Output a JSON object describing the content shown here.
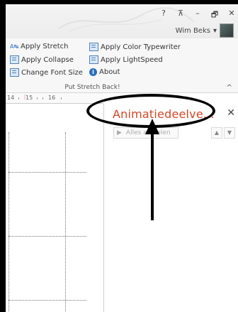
{
  "window": {
    "help_label": "?",
    "ribbon_display_label": "⊼",
    "minimize_label": "–",
    "restore_label": "🗗",
    "close_label": "✕",
    "user_name": "Wim Beks",
    "user_caret": "▾"
  },
  "ribbon": {
    "buttons": [
      {
        "label": "Apply Stretch",
        "icon": "stretch-icon"
      },
      {
        "label": "Apply Color Typewriter",
        "icon": "document-icon"
      },
      {
        "label": "Apply Collapse",
        "icon": "document-icon"
      },
      {
        "label": "Apply LightSpeed",
        "icon": "document-icon"
      },
      {
        "label": "Change Font Size",
        "icon": "document-icon"
      },
      {
        "label": "About",
        "icon": "info-icon"
      }
    ],
    "group_label": "Put Stretch Back!",
    "collapse_caret": "^"
  },
  "ruler": {
    "labels": [
      "14",
      "15",
      "16"
    ]
  },
  "task_pane": {
    "title": "Animatiedeelve...",
    "close_label": "✕",
    "play_label": "Alles afspelen",
    "up_label": "▲",
    "down_label": "▼"
  },
  "colors": {
    "accent_title": "#d24726",
    "annotation": "#000000"
  }
}
